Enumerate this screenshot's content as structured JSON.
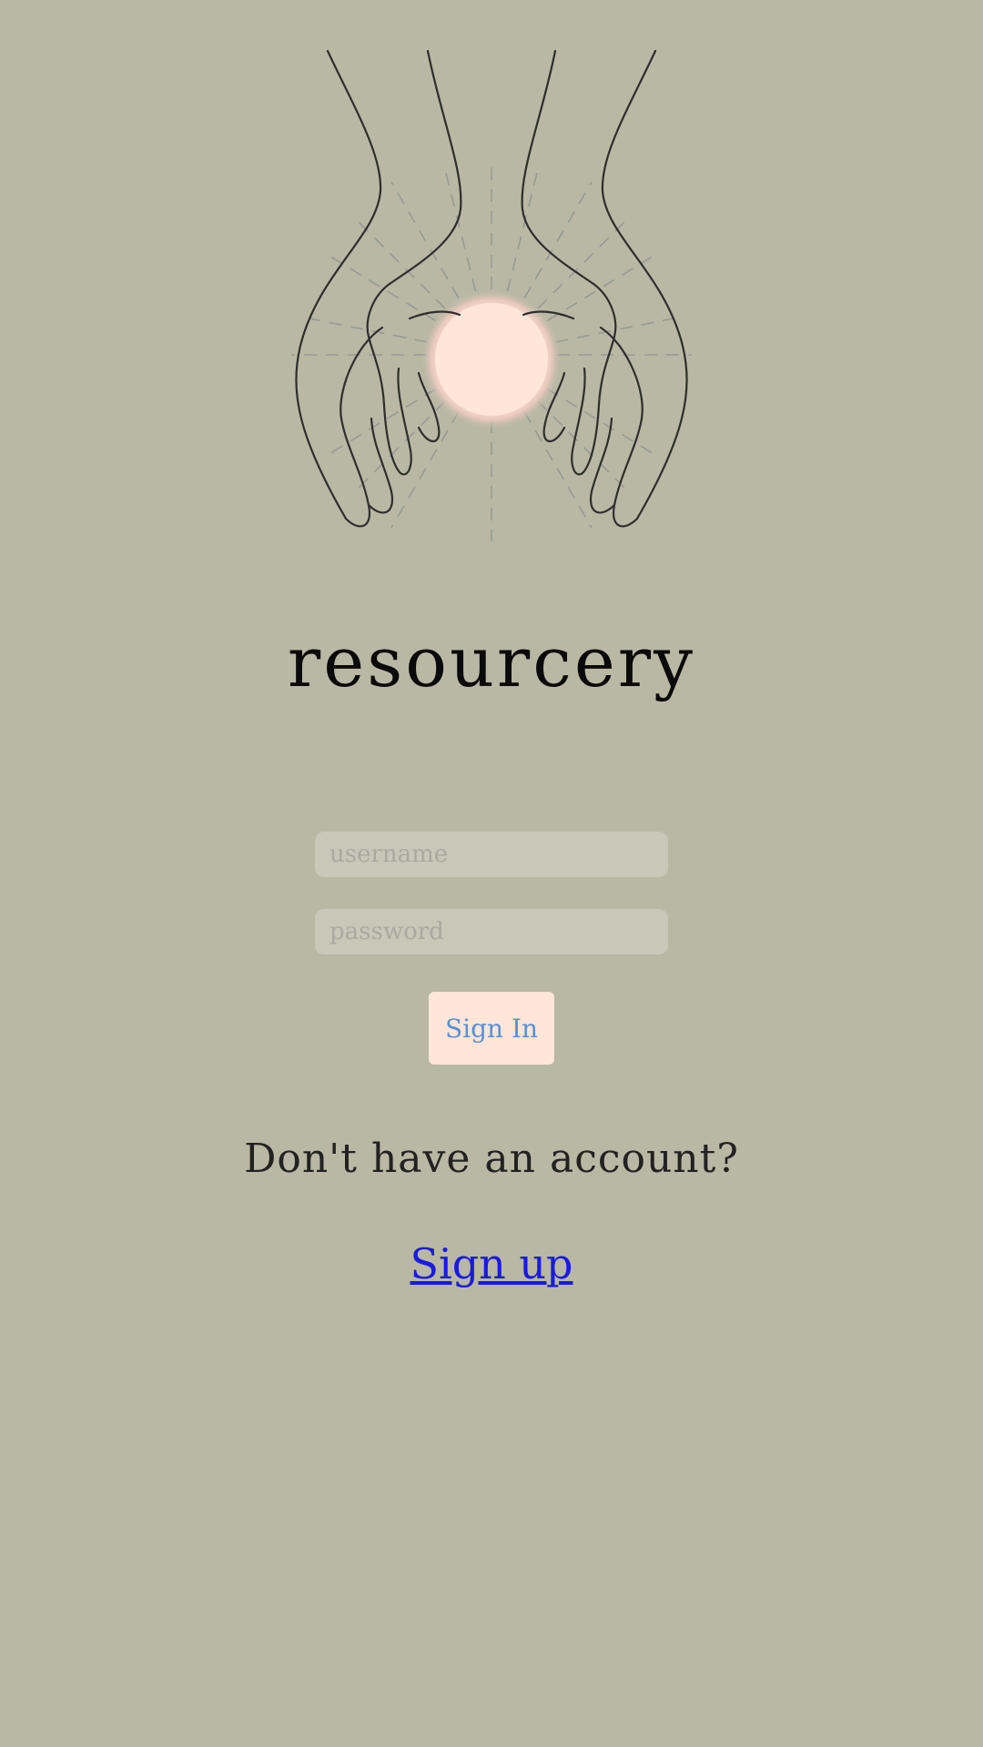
{
  "app": {
    "name": "resourcery",
    "logo_icon": "hands-holding-glowing-orb-icon"
  },
  "form": {
    "username_placeholder": "username",
    "password_placeholder": "password",
    "sign_in_label": "Sign In"
  },
  "footer": {
    "question": "Don't have an account?",
    "sign_up_label": "Sign up"
  },
  "colors": {
    "background": "#b8b8a4",
    "input_background": "#c8c8b8",
    "button_background": "#ffe6d8",
    "button_text": "#5b8fd6",
    "link": "#1a1ae0"
  }
}
